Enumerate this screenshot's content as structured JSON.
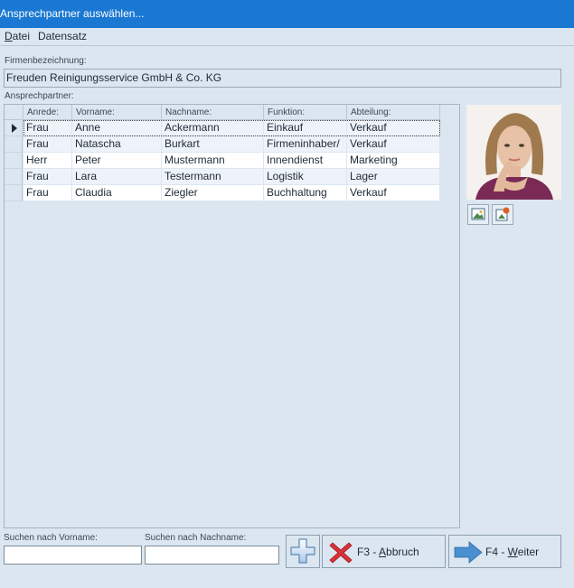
{
  "window": {
    "title": "Ansprechpartner auswählen..."
  },
  "menu": {
    "items": [
      {
        "label": "Datei",
        "mnemonic": "D",
        "rest": "atei"
      },
      {
        "label": "Datensatz",
        "mnemonic": "",
        "rest": "Datensatz"
      }
    ]
  },
  "company": {
    "label": "Firmenbezeichnung:",
    "value": "Freuden Reinigungsservice GmbH & Co. KG"
  },
  "contacts": {
    "label": "Ansprechpartner:",
    "columns": [
      "Anrede:",
      "Vorname:",
      "Nachname:",
      "Funktion:",
      "Abteilung:"
    ],
    "rows": [
      [
        "Frau",
        "Anne",
        "Ackermann",
        "Einkauf",
        "Verkauf"
      ],
      [
        "Frau",
        "Natascha",
        "Burkart",
        "Firmeninhaber/",
        "Verkauf"
      ],
      [
        "Herr",
        "Peter",
        "Mustermann",
        "Innendienst",
        "Marketing"
      ],
      [
        "Frau",
        "Lara",
        "Testermann",
        "Logistik",
        "Lager"
      ],
      [
        "Frau",
        "Claudia",
        "Ziegler",
        "Buchhaltung",
        "Verkauf"
      ]
    ],
    "selected_row": 0
  },
  "photo": {
    "icons": [
      "image-icon",
      "edit-image-icon"
    ]
  },
  "search": {
    "firstname_label": "Suchen nach Vorname:",
    "firstname_value": "",
    "lastname_label": "Suchen nach Nachname:",
    "lastname_value": ""
  },
  "buttons": {
    "add_icon": "plus-icon",
    "cancel_prefix": "F3 - ",
    "cancel_mnemonic": "A",
    "cancel_rest": "bbruch",
    "next_prefix": "F4 - ",
    "next_mnemonic": "W",
    "next_rest": "eiter"
  },
  "colors": {
    "titlebar": "#1a78d2",
    "background": "#dbe6f0",
    "cancel_icon": "#d9303a",
    "next_icon": "#4a8fd0"
  }
}
